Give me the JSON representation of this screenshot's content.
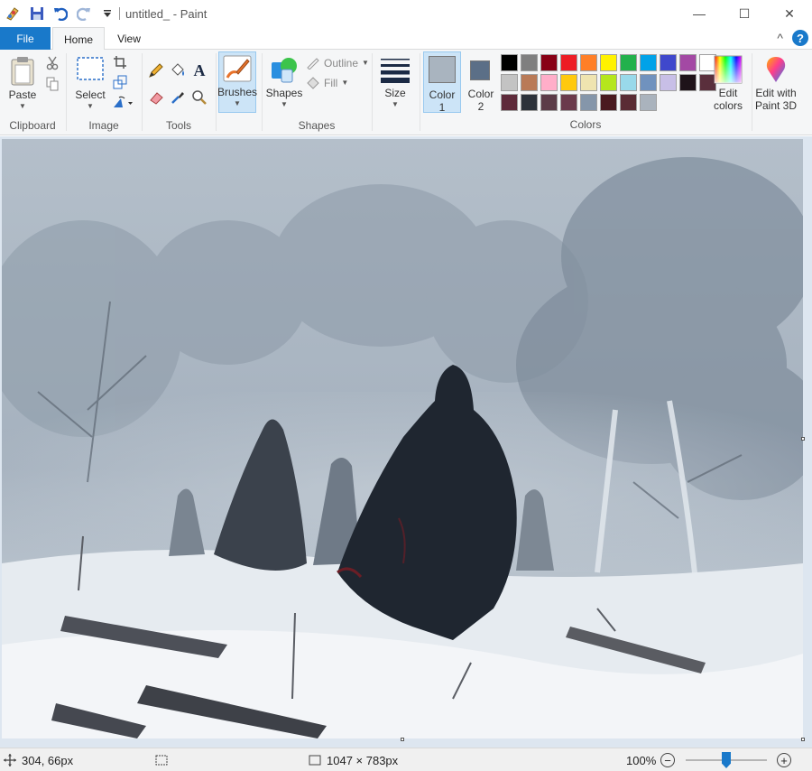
{
  "window": {
    "title": "untitled_ - Paint",
    "minimize_glyph": "—",
    "maximize_glyph": "☐",
    "close_glyph": "✕"
  },
  "tabs": {
    "file": "File",
    "home": "Home",
    "view": "View",
    "collapse_glyph": "^",
    "help_glyph": "?"
  },
  "ribbon": {
    "clipboard": {
      "paste": "Paste",
      "label": "Clipboard"
    },
    "image": {
      "select": "Select",
      "label": "Image"
    },
    "tools": {
      "label": "Tools",
      "text_glyph": "A"
    },
    "brushes": {
      "label": "Brushes"
    },
    "shapes": {
      "shapes": "Shapes",
      "outline": "Outline",
      "fill": "Fill",
      "label": "Shapes"
    },
    "size": {
      "label": "Size"
    },
    "colors": {
      "color1": "Color 1",
      "color1_line1": "Color",
      "color1_line2": "1",
      "color2_line1": "Color",
      "color2_line2": "2",
      "color1_value": "#a9b4bf",
      "color2_value": "#5b6f87",
      "edit_line1": "Edit",
      "edit_line2": "colors",
      "paint3d_line1": "Edit with",
      "paint3d_line2": "Paint 3D",
      "label": "Colors",
      "palette": [
        "#000000",
        "#7f7f7f",
        "#880015",
        "#ed1c24",
        "#ff7f27",
        "#fff200",
        "#22b14c",
        "#00a2e8",
        "#3f48cc",
        "#a349a4",
        "#ffffff",
        "#c3c3c3",
        "#b97a57",
        "#ffaec9",
        "#ffc90e",
        "#efe4b0",
        "#b5e61d",
        "#99d9ea",
        "#7092be",
        "#c8bfe7",
        "#1e1319",
        "#5a2f3c",
        "#5e2a3a",
        "#2c323a",
        "#5c3c48",
        "#6a3a4c",
        "#8596aa",
        "#4a1a20",
        "#5a2c34",
        "#aab3bd"
      ]
    }
  },
  "status": {
    "cursor_pos": "304, 66px",
    "canvas_size": "1047 × 783px",
    "zoom": "100%",
    "zoom_out_glyph": "−",
    "zoom_in_glyph": "+",
    "zoom_fraction": 0.5
  }
}
